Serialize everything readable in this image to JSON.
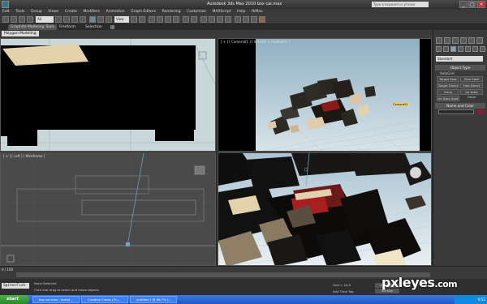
{
  "window": {
    "title": "Autodesk 3ds Max 2010     box car.max",
    "search_placeholder": "Type a keyword or phrase",
    "controls": [
      "_",
      "□",
      "×"
    ]
  },
  "menu": [
    "Edit",
    "Tools",
    "Group",
    "Views",
    "Create",
    "Modifiers",
    "Animation",
    "Graph Editors",
    "Rendering",
    "Customize",
    "MAXScript",
    "Help",
    "tkMax"
  ],
  "toolbar": {
    "selection_filter": "All",
    "view_dropdown": "View"
  },
  "ribbon": {
    "tabs": [
      "Graphite Modeling Tools",
      "Freeform",
      "Selection"
    ],
    "active_tab": "Graphite Modeling Tools",
    "sub_tab": "Polygon Modeling"
  },
  "viewports": {
    "top_label": "",
    "camera_label": "[ + ] [ Camera01 ] [ Smooth + Highlights ]",
    "left_label": "[ + ] [ Left ] [ Wireframe ]",
    "persp_label": "",
    "camera_tag": "Camera01"
  },
  "command_panel": {
    "category_dropdown": "Standard",
    "object_type_header": "Object Type",
    "autogrid_label": "AutoGrid",
    "object_buttons": [
      "Target Spot",
      "Free Spot",
      "Target Direct",
      "Free Direct",
      "Omni",
      "mr Area Omni",
      "mr Area Spot"
    ],
    "name_color_header": "Name and Color",
    "swatch_color": "#8b1a2a"
  },
  "timeline": {
    "frame_counter": "0 / 100"
  },
  "status": {
    "maxscript": "SpiterFish",
    "line1": "None Selected",
    "line2": "Click and drag to select and move objects",
    "coords": "Grid = 10.0",
    "add_time_tag": "Add Time Tag",
    "auto_key": "Auto Key",
    "set_key": "Set Key"
  },
  "taskbar": {
    "start": "start",
    "tasks": [
      "box car.max - Autod...",
      "Creative Cubes (E:\\...",
      "untitled-1 @ 66.7% (..."
    ],
    "tray_time": "6:52"
  },
  "watermark": {
    "text": "pxleyes",
    "suffix": ".com"
  }
}
